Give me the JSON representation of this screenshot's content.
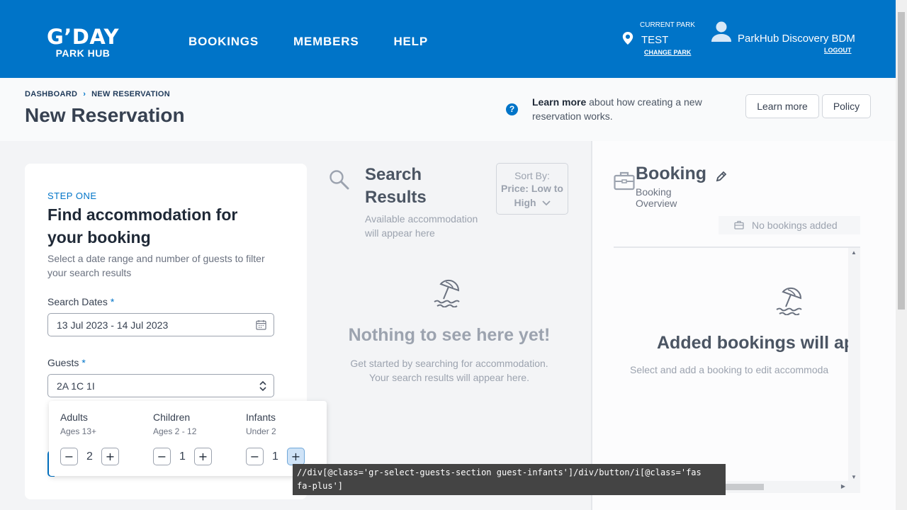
{
  "brand": {
    "logo_main": "G’DAY",
    "logo_sub": "PARK HUB",
    "color": "#0074c8"
  },
  "nav": {
    "items": [
      "BOOKINGS",
      "MEMBERS",
      "HELP"
    ]
  },
  "park": {
    "label": "CURRENT PARK",
    "name": "TEST",
    "change_label": "CHANGE PARK"
  },
  "user": {
    "name": "ParkHub Discovery BDM",
    "logout_label": "LOGOUT"
  },
  "breadcrumb": {
    "items": [
      "DASHBOARD",
      "NEW RESERVATION"
    ],
    "separator": "›"
  },
  "page": {
    "title": "New Reservation"
  },
  "help": {
    "icon_text": "?",
    "learn_bold": "Learn more",
    "learn_rest": " about how creating a new reservation works.",
    "learn_button": "Learn more",
    "policy_button": "Policy"
  },
  "step": {
    "label": "STEP ONE",
    "title": "Find accommodation for your booking",
    "description": "Select a date range and number of guests to filter your search results",
    "dates_label": "Search Dates",
    "dates_value": "13 Jul 2023 - 14 Jul 2023",
    "guests_label": "Guests",
    "guests_value": "2A 1C 1I",
    "required_mark": "*"
  },
  "guests": {
    "adults": {
      "label": "Adults",
      "sub": "Ages 13+",
      "value": "2"
    },
    "children": {
      "label": "Children",
      "sub": "Ages 2 - 12",
      "value": "1"
    },
    "infants": {
      "label": "Infants",
      "sub": "Under 2",
      "value": "1"
    },
    "minus": "−",
    "plus": "+"
  },
  "search": {
    "title": "Search Results",
    "subtitle": "Available accommodation will appear here",
    "sort_label": "Sort By:",
    "sort_value": "Price: Low to High",
    "empty_title": "Nothing to see here yet!",
    "empty_desc": "Get started by searching for accommodation. Your search results will appear here."
  },
  "booking": {
    "title": "Booking",
    "subtitle": "Booking Overview",
    "no_bookings": "No bookings added",
    "added_title": "Added bookings will ap",
    "added_desc": "Select and add a booking to edit accommoda"
  },
  "tooltip": {
    "text": "//div[@class='gr-select-guests-section guest-infants']/div/button/i[@class='fas fa-plus']"
  }
}
